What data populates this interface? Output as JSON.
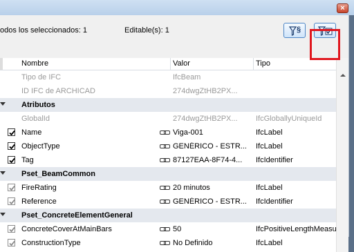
{
  "window": {
    "close_label": "×"
  },
  "summary": {
    "selected_text": "odos los seleccionados: 1",
    "editable_text": "Editable(s): 1"
  },
  "filters": {
    "filter1_label": "§",
    "filter1_icon": "funnel-section-icon",
    "filter2_icon": "funnel-checkbox-icon"
  },
  "table": {
    "headers": {
      "name": "Nombre",
      "value": "Valor",
      "type": "Tipo"
    },
    "rows": [
      {
        "kind": "readonly",
        "name": "Tipo de IFC",
        "value": "IfcBeam",
        "type": ""
      },
      {
        "kind": "readonly",
        "name": "ID IFC de ARCHICAD",
        "value": "274dwgZtHB2PX...",
        "type": ""
      },
      {
        "kind": "section",
        "name": "Atributos"
      },
      {
        "kind": "readonly",
        "name": "GlobalId",
        "value": "274dwgZtHB2PX...",
        "type": "IfcGloballyUniqueId"
      },
      {
        "kind": "editable",
        "checked": true,
        "dim": false,
        "link": true,
        "name": "Name",
        "value": "Viga-001",
        "type": "IfcLabel"
      },
      {
        "kind": "editable",
        "checked": true,
        "dim": false,
        "link": true,
        "name": "ObjectType",
        "value": "GENÉRICO - ESTR...",
        "type": "IfcLabel"
      },
      {
        "kind": "editable",
        "checked": true,
        "dim": false,
        "link": true,
        "name": "Tag",
        "value": "87127EAA-8F74-4...",
        "type": "IfcIdentifier"
      },
      {
        "kind": "section",
        "name": "Pset_BeamCommon"
      },
      {
        "kind": "editable",
        "checked": true,
        "dim": true,
        "link": true,
        "name": "FireRating",
        "value": "20 minutos",
        "type": "IfcLabel"
      },
      {
        "kind": "editable",
        "checked": true,
        "dim": true,
        "link": true,
        "name": "Reference",
        "value": "GENÉRICO - ESTR...",
        "type": "IfcIdentifier"
      },
      {
        "kind": "section",
        "name": "Pset_ConcreteElementGeneral"
      },
      {
        "kind": "editable",
        "checked": true,
        "dim": true,
        "link": true,
        "name": "ConcreteCoverAtMainBars",
        "value": "50",
        "type": "IfcPositiveLengthMeasure"
      },
      {
        "kind": "editable",
        "checked": true,
        "dim": true,
        "link": true,
        "name": "ConstructionType",
        "value": "No Definido",
        "type": "IfcLabel"
      }
    ]
  }
}
